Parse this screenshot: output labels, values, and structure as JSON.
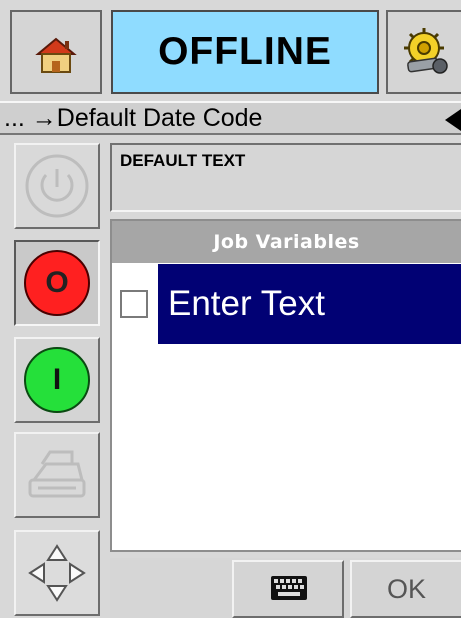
{
  "header": {
    "home_icon": "home-icon",
    "status": "OFFLINE",
    "status_color": "#8fdcff",
    "settings_icon": "gear-wrench-icon"
  },
  "breadcrumb": {
    "text": "... →Default Date Code"
  },
  "left_controls": {
    "power_icon": "power-icon",
    "stop_label": "O",
    "stop_color": "#ff2020",
    "start_label": "I",
    "start_color": "#25e03a",
    "print_icon": "printer-icon",
    "nav_icon": "directional-arrows-icon"
  },
  "main": {
    "default_text_label": "DEFAULT TEXT",
    "job_variables_title": "Job Variables",
    "items": [
      {
        "label": "Enter Text",
        "selected": true
      }
    ]
  },
  "footer": {
    "keyboard_icon": "keyboard-icon",
    "ok_label": "OK"
  }
}
